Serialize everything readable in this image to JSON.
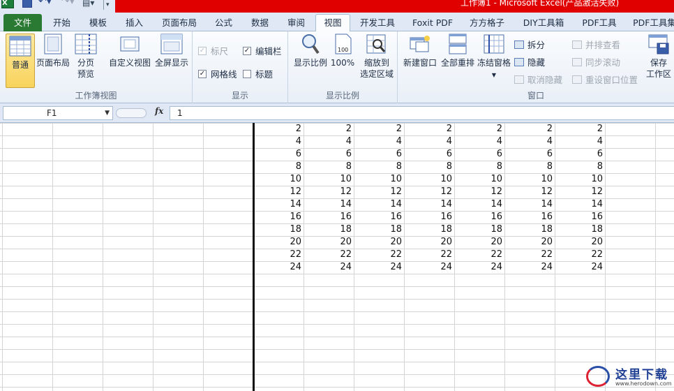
{
  "window": {
    "title": "工作簿1 - Microsoft Excel(产品激活失败)"
  },
  "quick_access": {
    "logo_icon": "excel-logo-icon",
    "save_icon": "save-icon",
    "undo_icon": "undo-icon",
    "redo_icon": "redo-icon",
    "print_icon": "print-preview-icon",
    "customize_icon": "customize-dropdown-icon"
  },
  "tabs": [
    {
      "label": "文件",
      "type": "file"
    },
    {
      "label": "开始"
    },
    {
      "label": "模板"
    },
    {
      "label": "插入"
    },
    {
      "label": "页面布局"
    },
    {
      "label": "公式"
    },
    {
      "label": "数据"
    },
    {
      "label": "审阅"
    },
    {
      "label": "视图",
      "active": true
    },
    {
      "label": "开发工具"
    },
    {
      "label": "Foxit PDF"
    },
    {
      "label": "方方格子"
    },
    {
      "label": "DIY工具箱"
    },
    {
      "label": "PDF工具"
    },
    {
      "label": "PDF工具集"
    }
  ],
  "ribbon": {
    "workbook_views": {
      "label": "工作簿视图",
      "normal": "普通",
      "page_layout": "页面布局",
      "page_break_line1": "分页",
      "page_break_line2": "预览",
      "custom_views": "自定义视图",
      "full_screen": "全屏显示"
    },
    "show": {
      "label": "显示",
      "ruler": "标尺",
      "formula_bar": "编辑栏",
      "gridlines": "网格线",
      "headings": "标题"
    },
    "zoom": {
      "label": "显示比例",
      "zoom": "显示比例",
      "hundred": "100%",
      "zoom_sel_line1": "缩放到",
      "zoom_sel_line2": "选定区域"
    },
    "window": {
      "label": "窗口",
      "new_window": "新建窗口",
      "arrange_all": "全部重排",
      "freeze_panes": "冻结窗格",
      "split": "拆分",
      "hide": "隐藏",
      "unhide": "取消隐藏",
      "side_by_side": "并排查看",
      "sync_scroll": "同步滚动",
      "reset_position": "重设窗口位置",
      "save_ws_line1": "保存",
      "save_ws_line2": "工作区"
    }
  },
  "formula_bar": {
    "name_box": "F1",
    "fx": "fx",
    "value": "1"
  },
  "sheet": {
    "rows": [
      [
        "2",
        "2",
        "2",
        "2",
        "2",
        "2",
        "2"
      ],
      [
        "4",
        "4",
        "4",
        "4",
        "4",
        "4",
        "4"
      ],
      [
        "6",
        "6",
        "6",
        "6",
        "6",
        "6",
        "6"
      ],
      [
        "8",
        "8",
        "8",
        "8",
        "8",
        "8",
        "8"
      ],
      [
        "10",
        "10",
        "10",
        "10",
        "10",
        "10",
        "10"
      ],
      [
        "12",
        "12",
        "12",
        "12",
        "12",
        "12",
        "12"
      ],
      [
        "14",
        "14",
        "14",
        "14",
        "14",
        "14",
        "14"
      ],
      [
        "16",
        "16",
        "16",
        "16",
        "16",
        "16",
        "16"
      ],
      [
        "18",
        "18",
        "18",
        "18",
        "18",
        "18",
        "18"
      ],
      [
        "20",
        "20",
        "20",
        "20",
        "20",
        "20",
        "20"
      ],
      [
        "22",
        "22",
        "22",
        "22",
        "22",
        "22",
        "22"
      ],
      [
        "24",
        "24",
        "24",
        "24",
        "24",
        "24",
        "24"
      ]
    ]
  },
  "watermark": {
    "text": "这里下载",
    "url": "www.herodown.com"
  }
}
